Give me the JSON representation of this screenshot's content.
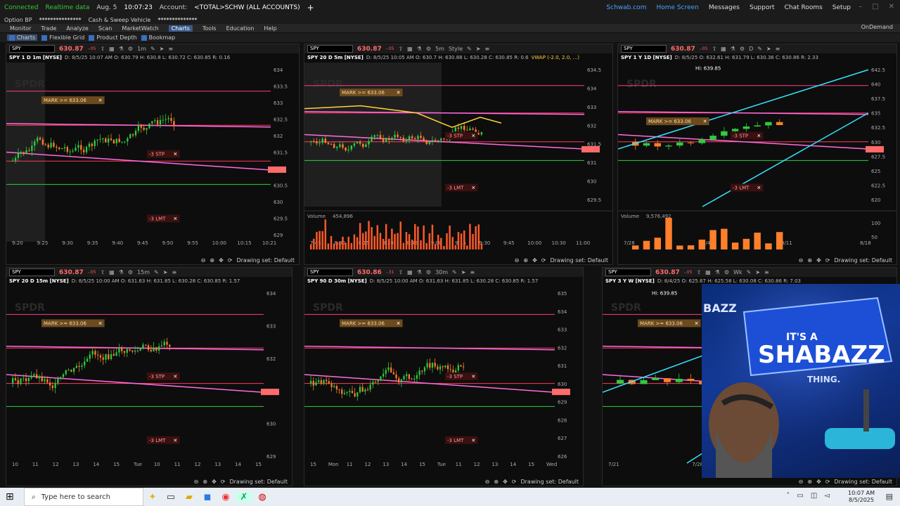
{
  "status": {
    "connected": "Connected",
    "realtime": "Realtime data",
    "date": "Aug. 5",
    "time": "10:07:23",
    "account_label": "Account:",
    "account": "<TOTAL>SCHW (ALL ACCOUNTS)",
    "add": "+"
  },
  "status2": {
    "option_bp_label": "Option BP",
    "option_bp": "***************",
    "cash_sweep": "Cash & Sweep Vehicle",
    "cash_value": "**************"
  },
  "topright": {
    "schwab": "Schwab.com",
    "home": "Home Screen",
    "messages": "Messages",
    "support": "Support",
    "chat": "Chat Rooms",
    "setup": "Setup"
  },
  "nav": [
    "Monitor",
    "Trade",
    "Analyze",
    "Scan",
    "MarketWatch",
    "Charts",
    "Tools",
    "Education",
    "Help"
  ],
  "nav_active": "Charts",
  "ondemand": "OnDemand",
  "subnav": [
    "Charts",
    "Flexible Grid",
    "Product Depth",
    "Bookmap"
  ],
  "panels": [
    {
      "symbol": "SPY",
      "price": "630.87",
      "chg": "-.05",
      "title": "SPY 1 D 1m [NYSE]",
      "ohlc": "D: 8/5/25 10:07 AM  O: 630.79  H: 630.8  L: 630.72  C: 630.85  R: 0.16",
      "tf": "1m",
      "yticks": [
        "634",
        "633.5",
        "633",
        "632.5",
        "632",
        "631.5",
        "631",
        "630.5",
        "630",
        "629.5",
        "629"
      ],
      "xticks": [
        "9:20",
        "9:25",
        "9:30",
        "9:35",
        "9:40",
        "9:45",
        "9:50",
        "9:55",
        "10:00",
        "10:15",
        "10:21"
      ],
      "mark": "MARK >= 633.06",
      "stp": "-3 STP",
      "lmt": "-3 LMT",
      "drawing": "Drawing set: Default"
    },
    {
      "symbol": "SPY",
      "price": "630.87",
      "chg": "-.05",
      "title": "SPY 20 D 5m [NYSE]",
      "ohlc": "D: 8/5/25 10:05 AM  O: 630.7  H: 630.88  L: 630.28  C: 630.85  R: 0.6",
      "study": "VWAP (-2.0, 2.0, ...)",
      "tf": "5m",
      "style": "Style",
      "yticks": [
        "634.5",
        "634",
        "633",
        "632",
        "631.5",
        "631",
        "630",
        "629.5"
      ],
      "xticks": [
        "7:45",
        "8:00",
        "8:15",
        "8:30",
        "8:45",
        "9:00",
        "9:15",
        "9:30",
        "9:45",
        "10:00",
        "10:30",
        "11:00"
      ],
      "volume_label": "Volume",
      "volume": "454,896",
      "mark": "MARK >= 633.06",
      "stp": "-3 STP",
      "lmt": "-3 LMT",
      "badge1": "632.71",
      "badge2": "631.72",
      "badge3": "630.85",
      "drawing": "Drawing set: Default"
    },
    {
      "symbol": "SPY",
      "price": "630.87",
      "chg": "-.05",
      "title": "SPY 1 Y 1D [NYSE]",
      "ohlc": "D: 8/5/25  O: 632.61  H: 631.79  L: 630.36  C: 630.86  R: 2.33",
      "tf": "D",
      "yticks": [
        "642.5",
        "640",
        "637.5",
        "635",
        "632.5",
        "630",
        "627.5",
        "625",
        "622.5",
        "620"
      ],
      "xticks": [
        "7/28",
        "8/4",
        "8/11",
        "8/18"
      ],
      "hi": "Hi: 639.85",
      "volume_label": "Volume",
      "volume": "9,576,492",
      "vticks": [
        "100",
        "50"
      ],
      "mark": "MARK >= 633.06",
      "stp": "-3 STP",
      "lmt": "-3 LMT",
      "drawing": "Drawing set: Default"
    },
    {
      "symbol": "SPY",
      "price": "630.87",
      "chg": "-.05",
      "title": "SPY 20 D 15m [NYSE]",
      "ohlc": "D: 8/5/25 10:00 AM  O: 631.63  H: 631.85  L: 630.28  C: 630.85  R: 1.57",
      "tf": "15m",
      "yticks": [
        "634",
        "633",
        "632",
        "631",
        "630",
        "629"
      ],
      "xticks": [
        "10",
        "11",
        "12",
        "13",
        "14",
        "15",
        "Tue",
        "10",
        "11",
        "12",
        "13",
        "14",
        "15"
      ],
      "mark": "MARK >= 633.06",
      "stp": "-3 STP",
      "lmt": "-3 LMT",
      "drawing": "Drawing set: Default"
    },
    {
      "symbol": "SPY",
      "price": "630.86",
      "chg": "-.31",
      "title": "SPY 90 D 30m [NYSE]",
      "ohlc": "D: 8/5/25 10:00 AM  O: 631.63  H: 631.85  L: 630.28  C: 630.85  R: 1.57",
      "tf": "30m",
      "yticks": [
        "635",
        "634",
        "633",
        "632",
        "631",
        "630",
        "629",
        "628",
        "627",
        "626"
      ],
      "xticks": [
        "15",
        "Mon",
        "11",
        "12",
        "13",
        "14",
        "15",
        "Tue",
        "11",
        "12",
        "13",
        "14",
        "15",
        "Wed"
      ],
      "mark": "MARK >= 633.06",
      "stp": "-3 STP",
      "lmt": "-3 LMT",
      "drawing": "Drawing set: Default"
    },
    {
      "symbol": "SPY",
      "price": "630.87",
      "chg": "-.05",
      "title": "SPY 3 Y W [NYSE]",
      "ohlc": "D: 8/4/25  O: 625.67  H: 625.58  L: 630.08  C: 630.86  R: 7.03",
      "tf": "Wk",
      "xticks": [
        "7/21",
        "7/28",
        "8/4",
        "8/11"
      ],
      "hi": "Hi: 639.85",
      "mark": "MARK >= 633.06",
      "drawing": "Drawing set: Default"
    }
  ],
  "webcam": {
    "banner1": "IT'S A",
    "banner2": "SHABAZZ",
    "banner3": "THING.",
    "side": "BAZZ"
  },
  "taskbar": {
    "search_placeholder": "Type here to search",
    "time": "10:07 AM",
    "date": "8/5/2025"
  },
  "colors": {
    "bg": "#0d0d0d",
    "green": "#2ecc40",
    "orange": "#ff7f2a",
    "magenta": "#ff4fd8",
    "red_line": "#ff3b5c",
    "cyan": "#36e3ff"
  }
}
